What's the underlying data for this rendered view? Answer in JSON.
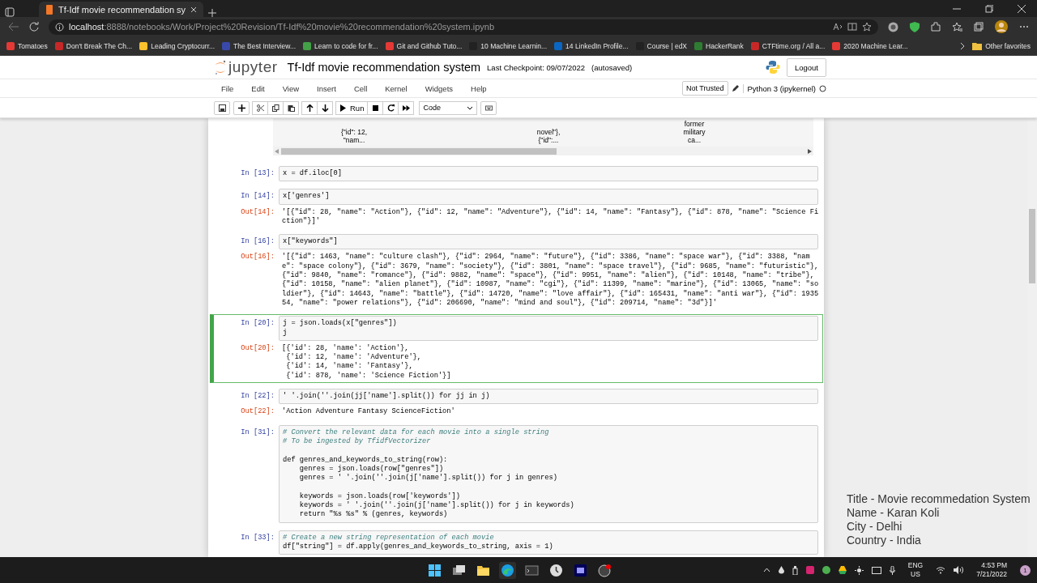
{
  "browser": {
    "tab_title": "Tf-Idf movie recommendation sy",
    "url_host": "localhost",
    "url_rest": ":8888/notebooks/Work/Project%20Revision/Tf-Idf%20movie%20recommendation%20system.ipynb",
    "bookmarks": [
      "Tomatoes",
      "Don't Break The Ch...",
      "Leading Cryptocurr...",
      "The Best Interview...",
      "Learn to code for fr...",
      "Git and Github Tuto...",
      "10 Machine Learnin...",
      "14 LinkedIn Profile...",
      "Course | edX",
      "HackerRank",
      "CTFtime.org / All a...",
      "2020 Machine Lear..."
    ],
    "other_favorites": "Other favorites"
  },
  "jupyter": {
    "logo_text": "jupyter",
    "title": "Tf-Idf movie recommendation system",
    "checkpoint": "Last Checkpoint: 09/07/2022",
    "autosave": "(autosaved)",
    "logout": "Logout",
    "menus": [
      "File",
      "Edit",
      "View",
      "Insert",
      "Cell",
      "Kernel",
      "Widgets",
      "Help"
    ],
    "trust": "Not Trusted",
    "kernel": "Python 3 (ipykernel)",
    "run": "Run",
    "cell_type": "Code"
  },
  "dataframe_tail": [
    [
      "{\"id\": 12,",
      "\"nam..."
    ],
    [
      "novel\"},",
      "{\"id\":..."
    ],
    [
      "former",
      "military",
      "ca..."
    ]
  ],
  "cells": [
    {
      "prompt": "In [13]:",
      "selected": false,
      "code": [
        {
          "kind": "code",
          "text": "x = df.iloc[0]"
        }
      ]
    },
    {
      "prompt": "In [14]:",
      "selected": false,
      "code": [
        {
          "kind": "code",
          "text": "x['genres']"
        }
      ],
      "out_prompt": "Out[14]:",
      "output": [
        "'[{\"id\": 28, \"name\": \"Action\"}, {\"id\": 12, \"name\": \"Adventure\"}, {\"id\": 14, \"name\": \"Fantasy\"}, {\"id\": 878, \"name\": \"Science Fi",
        "ction\"}]'"
      ]
    },
    {
      "prompt": "In [16]:",
      "selected": false,
      "code": [
        {
          "kind": "code",
          "text": "x[\"keywords\"]"
        }
      ],
      "out_prompt": "Out[16]:",
      "output": [
        "'[{\"id\": 1463, \"name\": \"culture clash\"}, {\"id\": 2964, \"name\": \"future\"}, {\"id\": 3386, \"name\": \"space war\"}, {\"id\": 3388, \"nam",
        "e\": \"space colony\"}, {\"id\": 3679, \"name\": \"society\"}, {\"id\": 3801, \"name\": \"space travel\"}, {\"id\": 9685, \"name\": \"futuristic\"},",
        "{\"id\": 9840, \"name\": \"romance\"}, {\"id\": 9882, \"name\": \"space\"}, {\"id\": 9951, \"name\": \"alien\"}, {\"id\": 10148, \"name\": \"tribe\"},",
        "{\"id\": 10158, \"name\": \"alien planet\"}, {\"id\": 10987, \"name\": \"cgi\"}, {\"id\": 11399, \"name\": \"marine\"}, {\"id\": 13065, \"name\": \"so",
        "ldier\"}, {\"id\": 14643, \"name\": \"battle\"}, {\"id\": 14720, \"name\": \"love affair\"}, {\"id\": 165431, \"name\": \"anti war\"}, {\"id\": 1935",
        "54, \"name\": \"power relations\"}, {\"id\": 206690, \"name\": \"mind and soul\"}, {\"id\": 209714, \"name\": \"3d\"}]'"
      ]
    },
    {
      "prompt": "In [20]:",
      "selected": true,
      "code": [
        {
          "kind": "code",
          "text": "j = json.loads(x[\"genres\"])"
        },
        {
          "kind": "code",
          "text": "j"
        }
      ],
      "out_prompt": "Out[20]:",
      "output": [
        "[{'id': 28, 'name': 'Action'},",
        " {'id': 12, 'name': 'Adventure'},",
        " {'id': 14, 'name': 'Fantasy'},",
        " {'id': 878, 'name': 'Science Fiction'}]"
      ]
    },
    {
      "prompt": "In [22]:",
      "selected": false,
      "code": [
        {
          "kind": "code",
          "text": "' '.join(''.join(jj['name'].split()) for jj in j)"
        }
      ],
      "out_prompt": "Out[22]:",
      "output": [
        "'Action Adventure Fantasy ScienceFiction'"
      ]
    },
    {
      "prompt": "In [31]:",
      "selected": false,
      "code": [
        {
          "kind": "comment",
          "text": "# Convert the relevant data for each movie into a single string"
        },
        {
          "kind": "comment",
          "text": "# To be ingested by TfidfVectorizer"
        },
        {
          "kind": "blank"
        },
        {
          "kind": "code",
          "text": "def genres_and_keywords_to_string(row):"
        },
        {
          "kind": "code",
          "text": "    genres = json.loads(row[\"genres\"])"
        },
        {
          "kind": "code",
          "text": "    genres = ' '.join(''.join(j['name'].split()) for j in genres)"
        },
        {
          "kind": "blank"
        },
        {
          "kind": "code",
          "text": "    keywords = json.loads(row['keywords'])"
        },
        {
          "kind": "code",
          "text": "    keywords = ' '.join(''.join(j['name'].split()) for j in keywords)"
        },
        {
          "kind": "code",
          "text": "    return \"%s %s\" % (genres, keywords)"
        }
      ]
    },
    {
      "prompt": "In [33]:",
      "selected": false,
      "code": [
        {
          "kind": "comment",
          "text": "# Create a new string representation of each movie"
        },
        {
          "kind": "code",
          "text": "df[\"string\"] = df.apply(genres_and_keywords_to_string, axis = 1)"
        }
      ]
    }
  ],
  "caption": [
    "Title - Movie recommedation System",
    "Name - Karan Koli",
    "City - Delhi",
    "Country - India"
  ],
  "taskbar": {
    "lang": "ENG",
    "region": "US",
    "time": "4:53 PM",
    "date": "7/21/2022",
    "notifications": "1"
  }
}
